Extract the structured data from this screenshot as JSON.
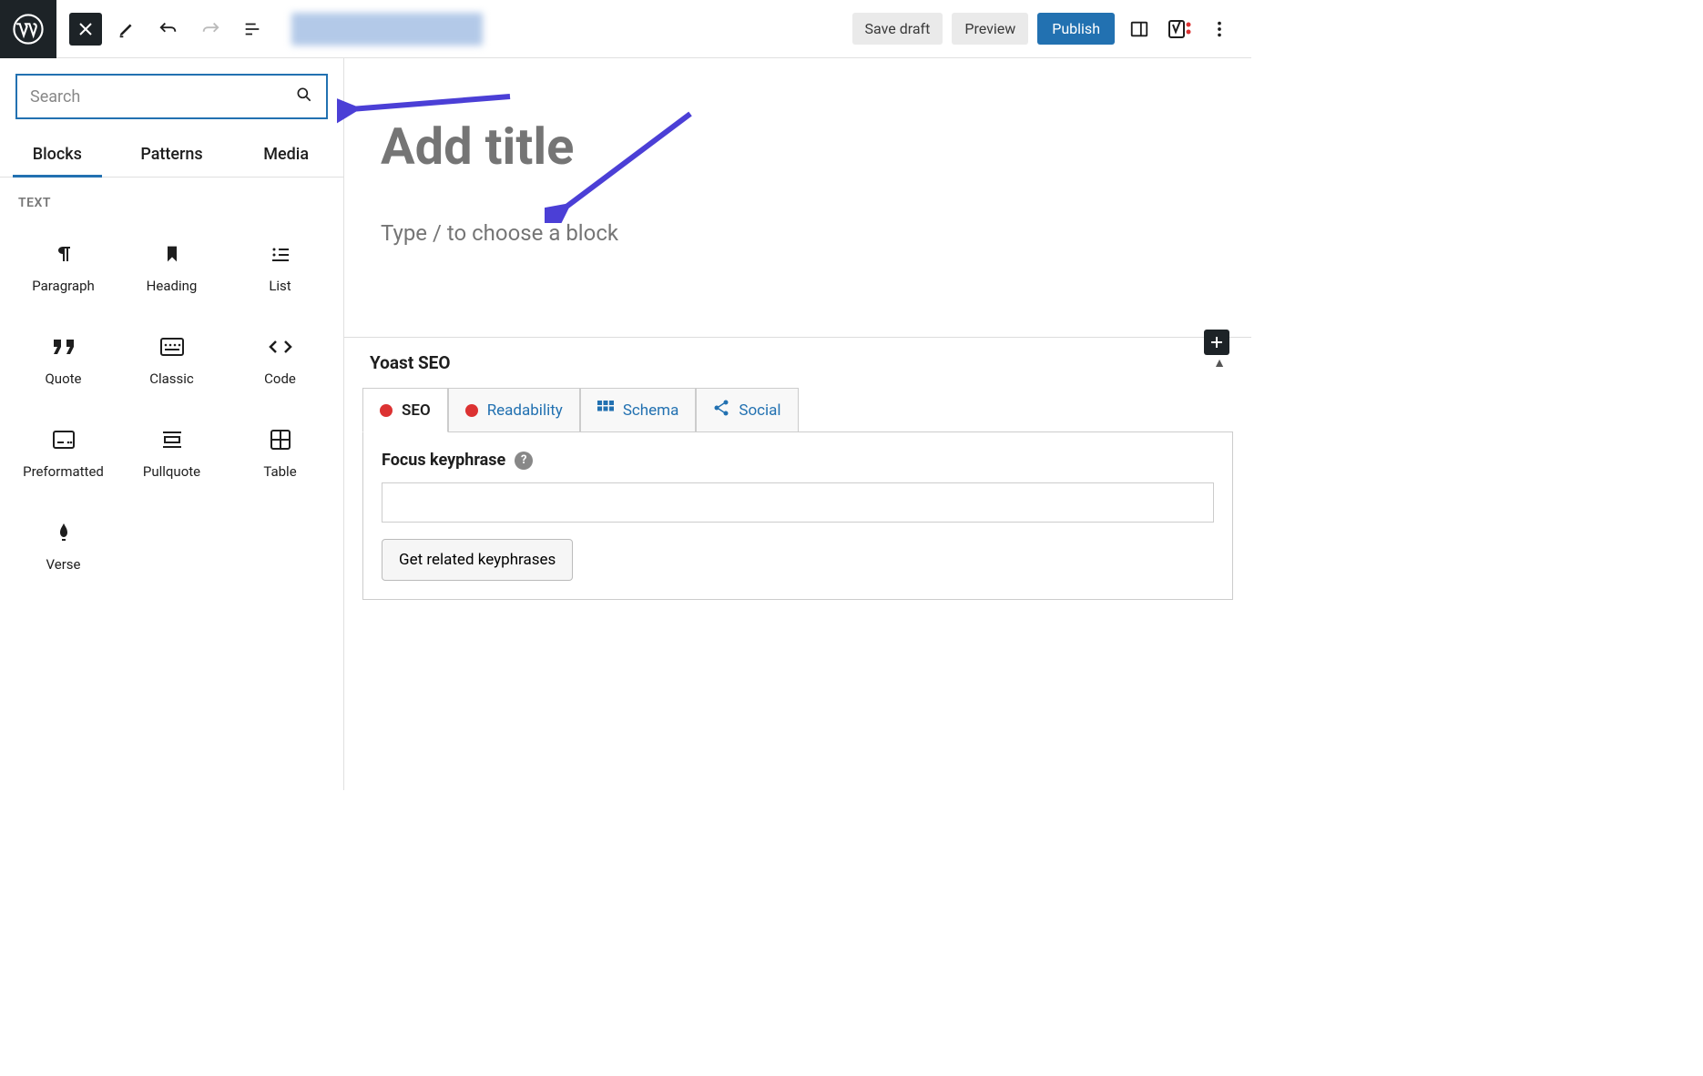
{
  "toolbar": {
    "save_draft": "Save draft",
    "preview": "Preview",
    "publish": "Publish"
  },
  "inserter": {
    "search_placeholder": "Search",
    "tabs": {
      "blocks": "Blocks",
      "patterns": "Patterns",
      "media": "Media"
    },
    "section_title": "TEXT",
    "blocks": {
      "paragraph": "Paragraph",
      "heading": "Heading",
      "list": "List",
      "quote": "Quote",
      "classic": "Classic",
      "code": "Code",
      "preformatted": "Preformatted",
      "pullquote": "Pullquote",
      "table": "Table",
      "verse": "Verse"
    }
  },
  "editor": {
    "title_placeholder": "Add title",
    "body_placeholder": "Type / to choose a block"
  },
  "yoast": {
    "title": "Yoast SEO",
    "tabs": {
      "seo": "SEO",
      "readability": "Readability",
      "schema": "Schema",
      "social": "Social"
    },
    "keyphrase_label": "Focus keyphrase",
    "related_btn": "Get related keyphrases"
  }
}
